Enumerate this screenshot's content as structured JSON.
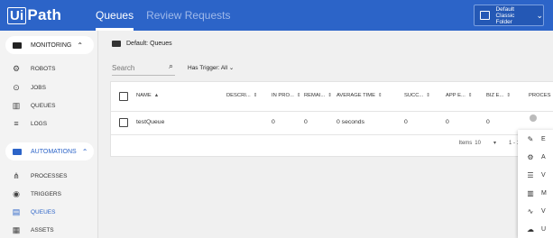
{
  "header": {
    "logo_ui": "Ui",
    "logo_path": "Path",
    "tabs": [
      {
        "label": "Queues",
        "active": true
      },
      {
        "label": "Review Requests",
        "active": false
      }
    ],
    "folder": {
      "line1": "Default",
      "line2": "Classic Folder"
    },
    "accent_color": "#2c64c8"
  },
  "sidebar": {
    "monitoring": {
      "label": "MONITORING",
      "items": [
        {
          "label": "ROBOTS",
          "icon": "robot-icon"
        },
        {
          "label": "JOBS",
          "icon": "play-circle-icon"
        },
        {
          "label": "QUEUES",
          "icon": "chart-icon"
        },
        {
          "label": "LOGS",
          "icon": "list-icon"
        }
      ]
    },
    "automations": {
      "label": "AUTOMATIONS",
      "items": [
        {
          "label": "PROCESSES",
          "icon": "hierarchy-icon"
        },
        {
          "label": "TRIGGERS",
          "icon": "trigger-icon"
        },
        {
          "label": "QUEUES",
          "icon": "queue-stack-icon",
          "active": true
        },
        {
          "label": "ASSETS",
          "icon": "asset-icon"
        }
      ]
    }
  },
  "main": {
    "breadcrumb": "Default: Queues",
    "search_placeholder": "Search",
    "filter_label": "Has Trigger: All",
    "columns": [
      "NAME",
      "DESCRI...",
      "IN PRO...",
      "REMAI...",
      "AVERAGE TIME",
      "SUCC...",
      "APP E...",
      "BIZ E...",
      "PROCES"
    ],
    "rows": [
      {
        "name": "testQueue",
        "in_progress": "0",
        "remaining": "0",
        "average_time": "0 seconds",
        "successful": "0",
        "app_exceptions": "0",
        "biz_exceptions": "0"
      }
    ],
    "footer": {
      "items_label": "Items",
      "per_page": "10",
      "range": "1 - 1"
    }
  },
  "context_menu": {
    "items": [
      {
        "label": "E",
        "icon": "pencil-icon"
      },
      {
        "label": "A",
        "icon": "settings-icon"
      },
      {
        "label": "V",
        "icon": "list-icon"
      },
      {
        "label": "M",
        "icon": "chart-icon"
      },
      {
        "label": "V",
        "icon": "pulse-icon"
      },
      {
        "label": "U",
        "icon": "upload-icon"
      }
    ]
  }
}
